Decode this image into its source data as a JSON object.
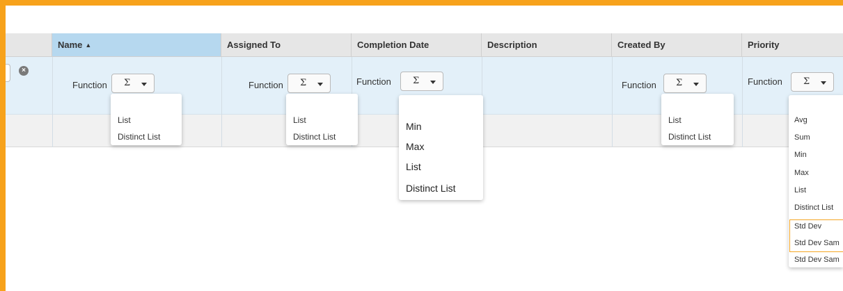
{
  "accent_color": "#f7a21b",
  "header": {
    "columns": [
      {
        "label": "Name",
        "sorted": "ascending"
      },
      {
        "label": "Assigned To"
      },
      {
        "label": "Completion Date"
      },
      {
        "label": "Description"
      },
      {
        "label": "Created By"
      },
      {
        "label": "Priority"
      }
    ],
    "sort_arrow": "▲"
  },
  "filter": {
    "clear_icon": "×",
    "function_label": "Function",
    "sigma": "Σ"
  },
  "dropdowns": {
    "name": [
      "List",
      "Distinct List"
    ],
    "assigned_to": [
      "List",
      "Distinct List"
    ],
    "completion_date": [
      "Min",
      "Max",
      "List",
      "Distinct List"
    ],
    "created_by": [
      "List",
      "Distinct List"
    ],
    "priority": [
      "Avg",
      "Sum",
      "Min",
      "Max",
      "List",
      "Distinct List",
      "Std Dev",
      "Std Dev Sam",
      "Std Dev Sam"
    ]
  }
}
